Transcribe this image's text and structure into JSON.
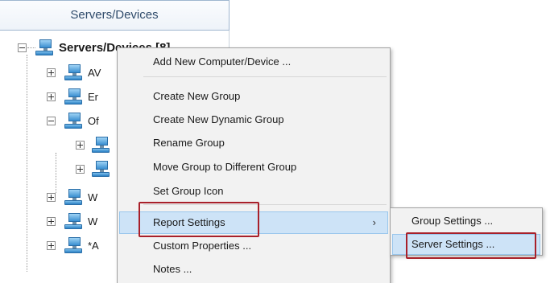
{
  "panel": {
    "header": "Servers/Devices",
    "root_label": "Servers/Devices [8]",
    "partial_labels": [
      "AV",
      "Er",
      "Of",
      "W",
      "W",
      "*A"
    ]
  },
  "context_menu": {
    "items": [
      {
        "label": "Add New Computer/Device ..."
      },
      {
        "label": "Create New Group"
      },
      {
        "label": "Create New Dynamic Group"
      },
      {
        "label": "Rename Group"
      },
      {
        "label": "Move Group to Different Group"
      },
      {
        "label": "Set Group Icon"
      },
      {
        "label": "Report Settings",
        "has_submenu": true,
        "submenu_arrow": "›"
      },
      {
        "label": "Custom Properties ..."
      },
      {
        "label": "Notes ..."
      }
    ]
  },
  "submenu": {
    "items": [
      {
        "label": "Group Settings ..."
      },
      {
        "label": "Server Settings ..."
      }
    ]
  },
  "highlight_color": "#a8202a",
  "selection_color": "#cde3f7"
}
